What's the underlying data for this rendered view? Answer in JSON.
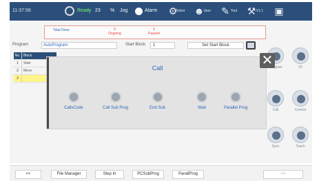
{
  "status_bar": {
    "time": "11:37:56",
    "state": "Ready",
    "speed": "23",
    "speed_unit": "%",
    "mode": "Jog",
    "alarm": "Alarm",
    "icons": [
      {
        "name": "robot-icon",
        "sub": "Robot"
      },
      {
        "name": "user-icon",
        "sub": "User"
      },
      {
        "name": "tool-icon",
        "sub": "Tool"
      },
      {
        "name": "arm-icon",
        "sub": "V1.1"
      },
      {
        "name": "camera-icon",
        "sub": ""
      }
    ]
  },
  "info": {
    "label": "Total Done",
    "col1_top": "0",
    "col1_bottom": "Ongoing",
    "col2_top": "0",
    "col2_bottom": "Paused"
  },
  "program": {
    "label": "Program",
    "value": "AutoProgram",
    "start_label": "Start Block",
    "start_value": "1",
    "set_start_button": "Set Start Block"
  },
  "grid": {
    "header": [
      "No.",
      "Block"
    ],
    "rows": [
      {
        "no": "1",
        "text": "Start"
      },
      {
        "no": "2",
        "text": "Move"
      },
      {
        "no": "3",
        "text": ""
      }
    ]
  },
  "right_icons": [
    {
      "name": "program-icon",
      "label": "Program"
    },
    {
      "name": "io-icon",
      "label": "IO"
    },
    {
      "name": "call-icon",
      "label": "Call"
    },
    {
      "name": "control-icon",
      "label": "Control"
    },
    {
      "name": "sync-icon",
      "label": "Sync"
    },
    {
      "name": "teach-icon",
      "label": "Teach"
    }
  ],
  "dialog": {
    "title": "Call",
    "options": [
      {
        "name": "callscode-icon",
        "label": "CallsCode"
      },
      {
        "name": "call-subprog-icon",
        "label": "Call Sub Prog"
      },
      {
        "name": "end-sub-icon",
        "label": "End Sub"
      },
      {
        "name": "wait-icon",
        "label": "Wait"
      },
      {
        "name": "parallel-prog-icon",
        "label": "Parallel Prog"
      }
    ]
  },
  "bottom_tabs": [
    {
      "label": "<<",
      "w": 38
    },
    {
      "label": "File Manager",
      "w": 52
    },
    {
      "label": "Step In",
      "w": 42
    },
    {
      "label": "PCSubProg",
      "w": 46
    },
    {
      "label": "ParallProg",
      "w": 46
    },
    {
      "label": ">>",
      "w": 58
    }
  ]
}
